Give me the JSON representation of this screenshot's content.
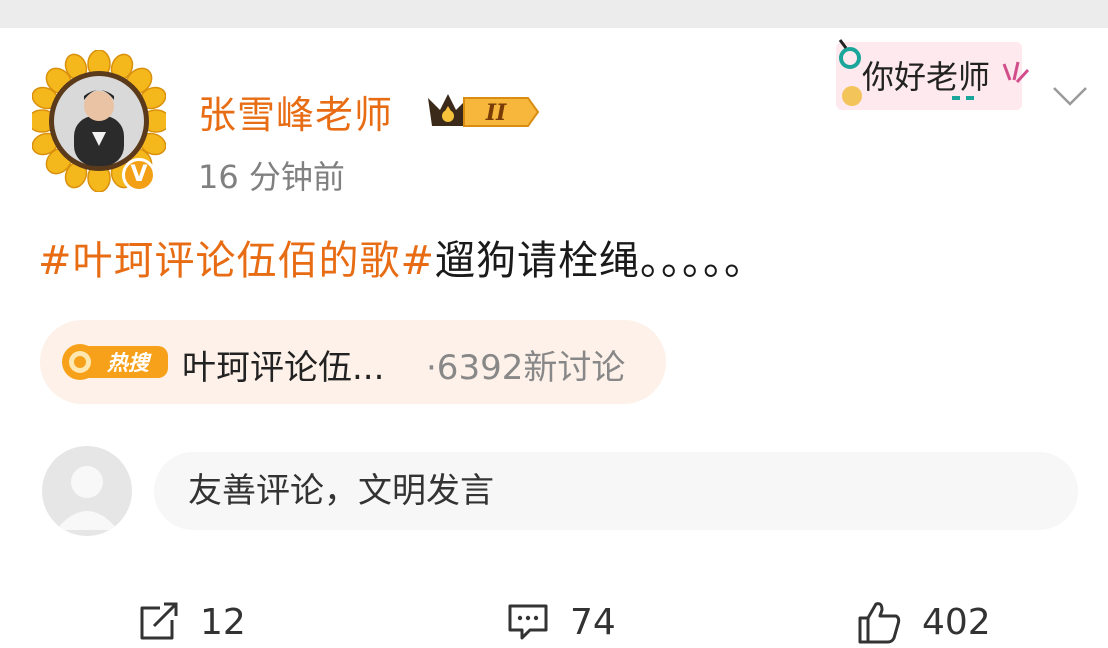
{
  "user": {
    "name": "张雪峰老师",
    "level_badge": "II",
    "verified_mark": "V",
    "time": "16 分钟前"
  },
  "sticker": {
    "text": "你好老师"
  },
  "post": {
    "hashtag": "#叶珂评论伍佰的歌#",
    "body": "遛狗请栓绳。。。。。"
  },
  "hot_search": {
    "badge": "热搜",
    "title": "叶珂评论伍...",
    "count": "·6392新讨论"
  },
  "comment_box": {
    "placeholder": "友善评论，文明发言"
  },
  "actions": {
    "repost_count": "12",
    "comment_count": "74",
    "like_count": "402"
  },
  "colors": {
    "accent": "#e86c13",
    "badge": "#f4a015",
    "hot_bg": "#fdf1e9"
  },
  "icons": [
    "more-chevron-icon",
    "crown-icon",
    "search-icon",
    "repost-icon",
    "comment-icon",
    "like-icon"
  ]
}
